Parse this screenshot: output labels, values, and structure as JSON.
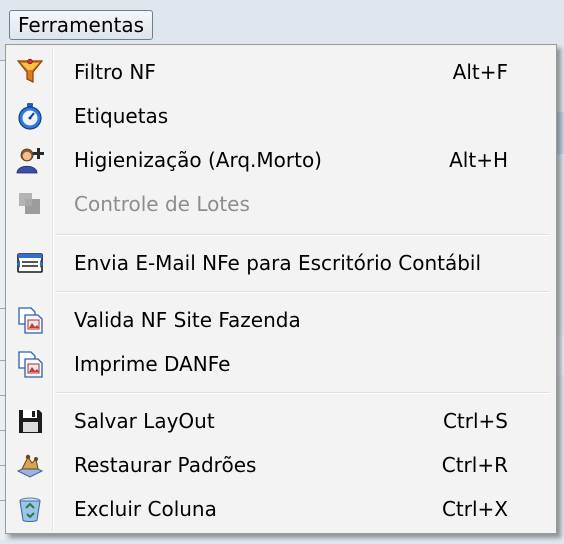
{
  "menubar": {
    "title": "Ferramentas"
  },
  "menu": {
    "items": [
      {
        "label": "Filtro NF",
        "shortcut": "Alt+F",
        "icon": "funnel-icon"
      },
      {
        "label": "Etiquetas",
        "shortcut": "",
        "icon": "stopwatch-icon"
      },
      {
        "label": "Higienização (Arq.Morto)",
        "shortcut": "Alt+H",
        "icon": "add-user-icon"
      },
      {
        "label": "Controle de Lotes",
        "shortcut": "",
        "icon": "stack-icon",
        "disabled": true
      },
      {
        "label": "Envia E-Mail NFe para Escritório Contábil",
        "shortcut": "",
        "icon": "email-card-icon"
      },
      {
        "label": "Valida NF Site Fazenda",
        "shortcut": "",
        "icon": "document-icon"
      },
      {
        "label": "Imprime DANFe",
        "shortcut": "",
        "icon": "document-icon"
      },
      {
        "label": "Salvar LayOut",
        "shortcut": "Ctrl+S",
        "icon": "floppy-disk-icon"
      },
      {
        "label": "Restaurar Padrões",
        "shortcut": "Ctrl+R",
        "icon": "restore-icon"
      },
      {
        "label": "Excluir Coluna",
        "shortcut": "Ctrl+X",
        "icon": "recycle-bin-icon"
      }
    ]
  },
  "colors": {
    "menu_bg": "#f3f3f3",
    "disabled_text": "#8d8d8d",
    "accent_blue": "#2f6fd0"
  }
}
